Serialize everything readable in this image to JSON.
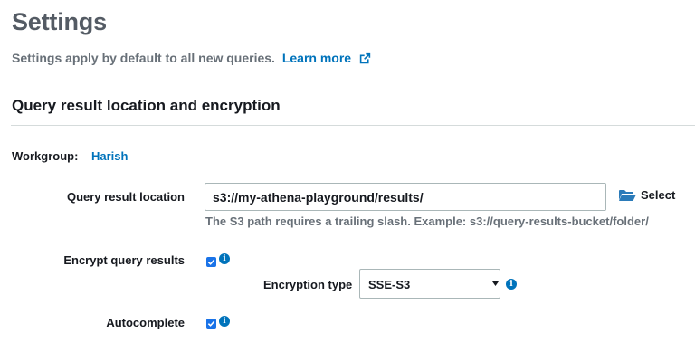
{
  "page": {
    "title": "Settings",
    "subtitle": "Settings apply by default to all new queries.",
    "learn_more": "Learn more"
  },
  "section": {
    "title": "Query result location and encryption"
  },
  "workgroup": {
    "label": "Workgroup:",
    "value": "Harish"
  },
  "query_result_location": {
    "label": "Query result location",
    "value": "s3://my-athena-playground/results/",
    "hint": "The S3 path requires a trailing slash. Example: s3://query-results-bucket/folder/",
    "select_label": "Select"
  },
  "encrypt_query_results": {
    "label": "Encrypt query results",
    "checked": true
  },
  "encryption_type": {
    "label": "Encryption type",
    "value": "SSE-S3"
  },
  "autocomplete": {
    "label": "Autocomplete",
    "checked": true
  },
  "colors": {
    "link": "#0073bb",
    "checkbox": "#1a73e8",
    "muted_text": "#687078",
    "title_text": "#545b64"
  },
  "icons": {
    "external_link": "external-link-icon",
    "folder": "folder-open-icon",
    "info": "info-icon",
    "checkmark": "checkmark-icon",
    "dropdown": "caret-down-icon"
  }
}
